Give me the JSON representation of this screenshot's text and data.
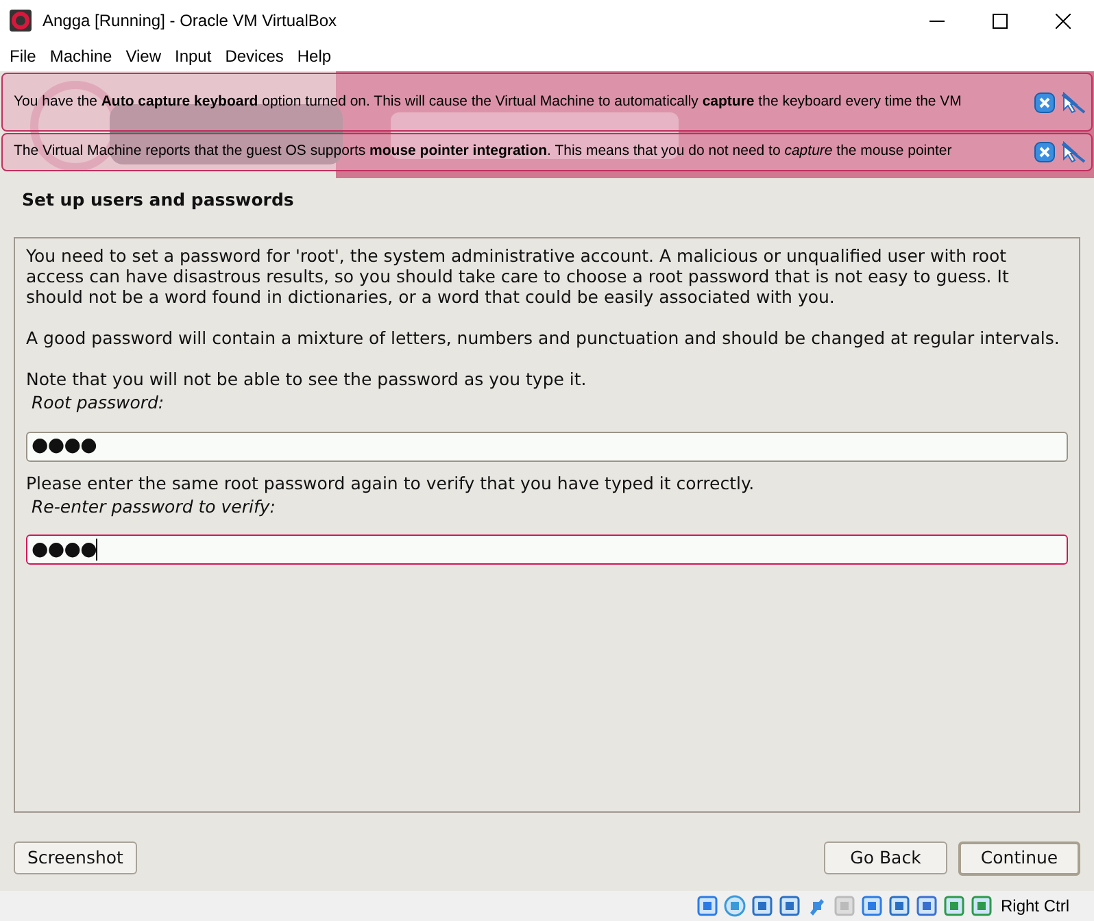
{
  "window": {
    "title": "Angga [Running] - Oracle VM VirtualBox"
  },
  "menu": [
    "File",
    "Machine",
    "View",
    "Input",
    "Devices",
    "Help"
  ],
  "notifications": [
    {
      "text": "You have the **Auto capture keyboard** option turned on. This will cause the Virtual Machine to automatically **capture** the keyboard every time the VM"
    },
    {
      "text": "The Virtual Machine reports that the guest OS supports **mouse pointer integration**. This means that you do not need to *capture* the mouse pointer"
    }
  ],
  "heading": "Set up users and passwords",
  "content": [
    {
      "kind": "paragraph",
      "text": "You need to set a password for 'root', the system administrative account. A malicious or unqualified user with root access can have disastrous results, so you should take care to choose a root password that is not easy to guess. It should not be a word found in dictionaries, or a word that could be easily associated with you."
    },
    {
      "kind": "paragraph",
      "text": "A good password will contain a mixture of letters, numbers and punctuation and should be changed at regular intervals."
    },
    {
      "kind": "paragraph",
      "text": "Note that you will not be able to see the password as you type it."
    },
    {
      "kind": "label",
      "text": "Root password:"
    },
    {
      "kind": "field",
      "value": "●●●●",
      "focused": false
    },
    {
      "kind": "paragraph",
      "text": "Please enter the same root password again to verify that you have typed it correctly."
    },
    {
      "kind": "label",
      "text": "Re-enter password to verify:"
    },
    {
      "kind": "field",
      "value": "●●●●",
      "focused": true
    }
  ],
  "buttons": {
    "left": "Screenshot",
    "back": "Go Back",
    "next": "Continue"
  },
  "status_bar": {
    "host_key": "Right Ctrl"
  }
}
